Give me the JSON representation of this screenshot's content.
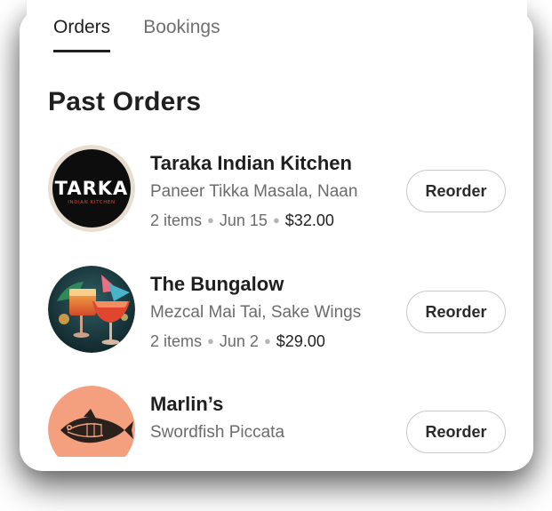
{
  "tabs": [
    {
      "label": "Orders",
      "active": true
    },
    {
      "label": "Bookings",
      "active": false
    }
  ],
  "section_title": "Past Orders",
  "orders": [
    {
      "restaurant": "Taraka Indian Kitchen",
      "items_desc": "Paneer Tikka Masala, Naan",
      "count": "2 items",
      "date": "Jun 15",
      "price": "$32.00",
      "button": "Reorder",
      "logo_text": "TARKA",
      "logo_subtext": "INDIAN KITCHEN"
    },
    {
      "restaurant": "The Bungalow",
      "items_desc": "Mezcal Mai Tai, Sake Wings",
      "count": "2 items",
      "date": "Jun 2",
      "price": "$29.00",
      "button": "Reorder"
    },
    {
      "restaurant": "Marlin’s",
      "items_desc": "Swordfish Piccata",
      "count": "",
      "date": "",
      "price": "",
      "button": "Reorder"
    }
  ],
  "colors": {
    "text_primary": "#1f1f1f",
    "text_secondary": "#6b6b6b",
    "button_border": "#c8c8c8",
    "marlins_bg": "#f4a07e"
  }
}
